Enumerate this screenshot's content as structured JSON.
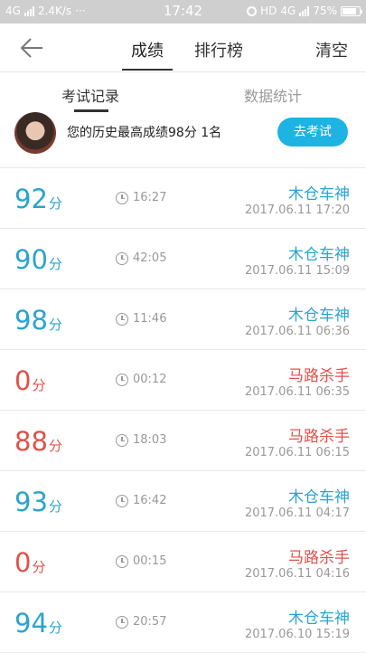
{
  "status_bar": {
    "network": "4G",
    "speed": "2.4K/s",
    "dots": "···",
    "time": "17:42",
    "hd": "HD",
    "network2": "4G",
    "battery": "75%",
    "battery_level": 0.75
  },
  "navbar": {
    "tabs": [
      "成绩",
      "排行榜"
    ],
    "active_tab": 0,
    "clear_label": "清空"
  },
  "subtabs": {
    "items": [
      "考试记录",
      "数据统计"
    ],
    "active": 0
  },
  "profile": {
    "text": "您的历史最高成绩98分 1名",
    "exam_button": "去考试"
  },
  "records": [
    {
      "score": "92",
      "unit": "分",
      "duration": "16:27",
      "title": "木仓车神",
      "date": "2017.06.11  17:20",
      "status": "good"
    },
    {
      "score": "90",
      "unit": "分",
      "duration": "42:05",
      "title": "木仓车神",
      "date": "2017.06.11  15:09",
      "status": "good"
    },
    {
      "score": "98",
      "unit": "分",
      "duration": "11:46",
      "title": "木仓车神",
      "date": "2017.06.11  06:36",
      "status": "good"
    },
    {
      "score": "0",
      "unit": "分",
      "duration": "00:12",
      "title": "马路杀手",
      "date": "2017.06.11  06:35",
      "status": "bad"
    },
    {
      "score": "88",
      "unit": "分",
      "duration": "18:03",
      "title": "马路杀手",
      "date": "2017.06.11  06:15",
      "status": "bad"
    },
    {
      "score": "93",
      "unit": "分",
      "duration": "16:42",
      "title": "木仓车神",
      "date": "2017.06.11  04:17",
      "status": "good"
    },
    {
      "score": "0",
      "unit": "分",
      "duration": "00:15",
      "title": "马路杀手",
      "date": "2017.06.11  04:16",
      "status": "bad"
    },
    {
      "score": "94",
      "unit": "分",
      "duration": "20:57",
      "title": "木仓车神",
      "date": "2017.06.10  15:19",
      "status": "good"
    }
  ],
  "colors": {
    "good": "#2aa4cf",
    "bad": "#e0514b",
    "accent": "#1db3e2"
  }
}
